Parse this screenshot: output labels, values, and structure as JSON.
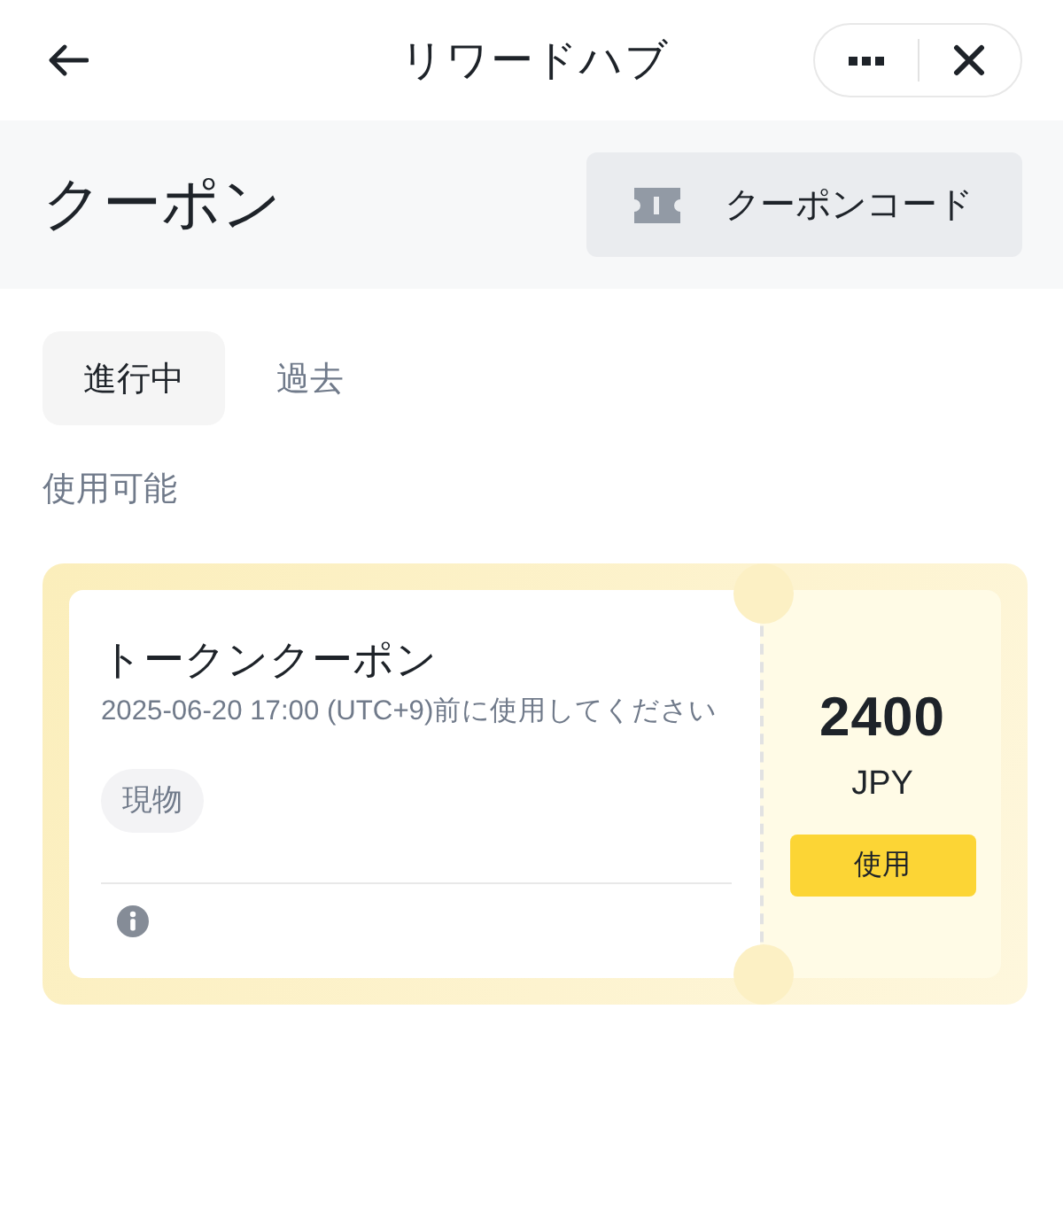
{
  "nav": {
    "title": "リワードハブ"
  },
  "header": {
    "title": "クーポン",
    "code_button": "クーポンコード"
  },
  "tabs": [
    {
      "label": "進行中",
      "selected": true
    },
    {
      "label": "過去",
      "selected": false
    }
  ],
  "section_label": "使用可能",
  "coupons": [
    {
      "title": "トークンクーポン",
      "expiry": "2025-06-20 17:00 (UTC+9)前に使用してください",
      "tag": "現物",
      "amount": "2400",
      "currency": "JPY",
      "action": "使用"
    }
  ]
}
